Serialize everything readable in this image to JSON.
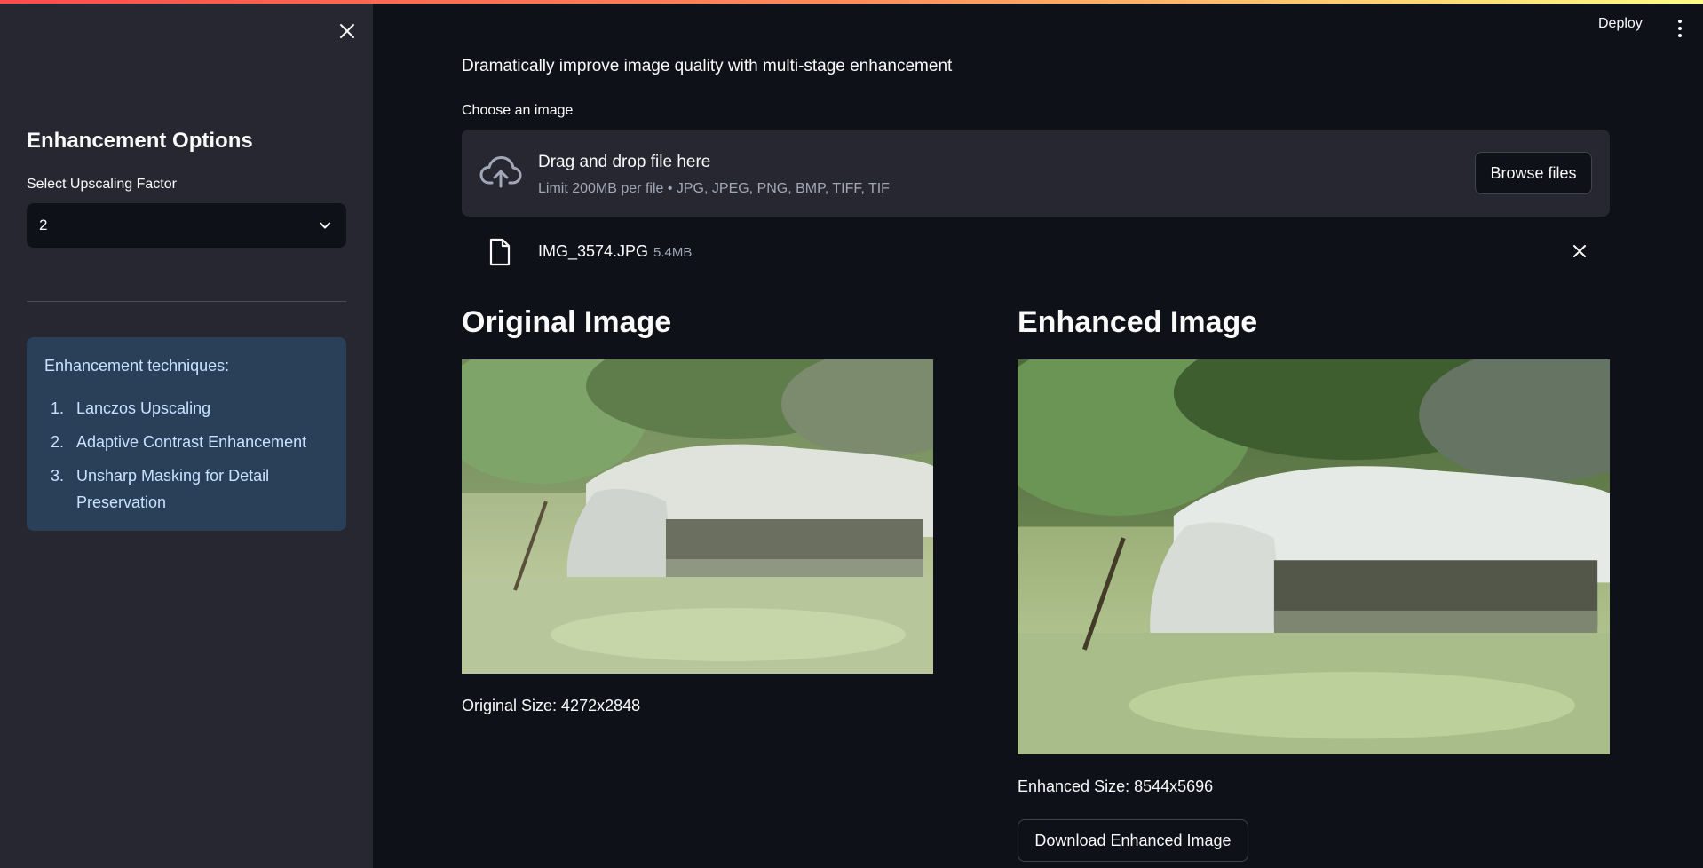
{
  "sidebar": {
    "close_icon": "close-icon",
    "title": "Enhancement Options",
    "select_label": "Select Upscaling Factor",
    "select_value": "2",
    "info": {
      "title": "Enhancement techniques:",
      "items": [
        {
          "num": "1.",
          "text": "Lanczos Upscaling"
        },
        {
          "num": "2.",
          "text": "Adaptive Contrast Enhancement"
        },
        {
          "num": "3.",
          "text": "Unsharp Masking for Detail Preservation"
        }
      ]
    }
  },
  "header": {
    "deploy_label": "Deploy",
    "menu_icon": "kebab-menu-icon"
  },
  "main": {
    "subtitle": "Dramatically improve image quality with multi-stage enhancement",
    "uploader": {
      "label": "Choose an image",
      "drop_title": "Drag and drop file here",
      "drop_limit": "Limit 200MB per file • JPG, JPEG, PNG, BMP, TIFF, TIF",
      "browse_label": "Browse files",
      "file": {
        "name": "IMG_3574.JPG",
        "size": "5.4MB"
      }
    },
    "original": {
      "heading": "Original Image",
      "size_text": "Original Size: 4272x2848"
    },
    "enhanced": {
      "heading": "Enhanced Image",
      "size_text": "Enhanced Size: 8544x5696",
      "download_label": "Download Enhanced Image"
    }
  },
  "colors": {
    "background": "#0e1117",
    "sidebar": "#262730",
    "info_box": "#2a3f58",
    "info_text": "#c7e3ff",
    "accent_gradient_start": "#ff4b4b",
    "accent_gradient_end": "#fffd80"
  }
}
